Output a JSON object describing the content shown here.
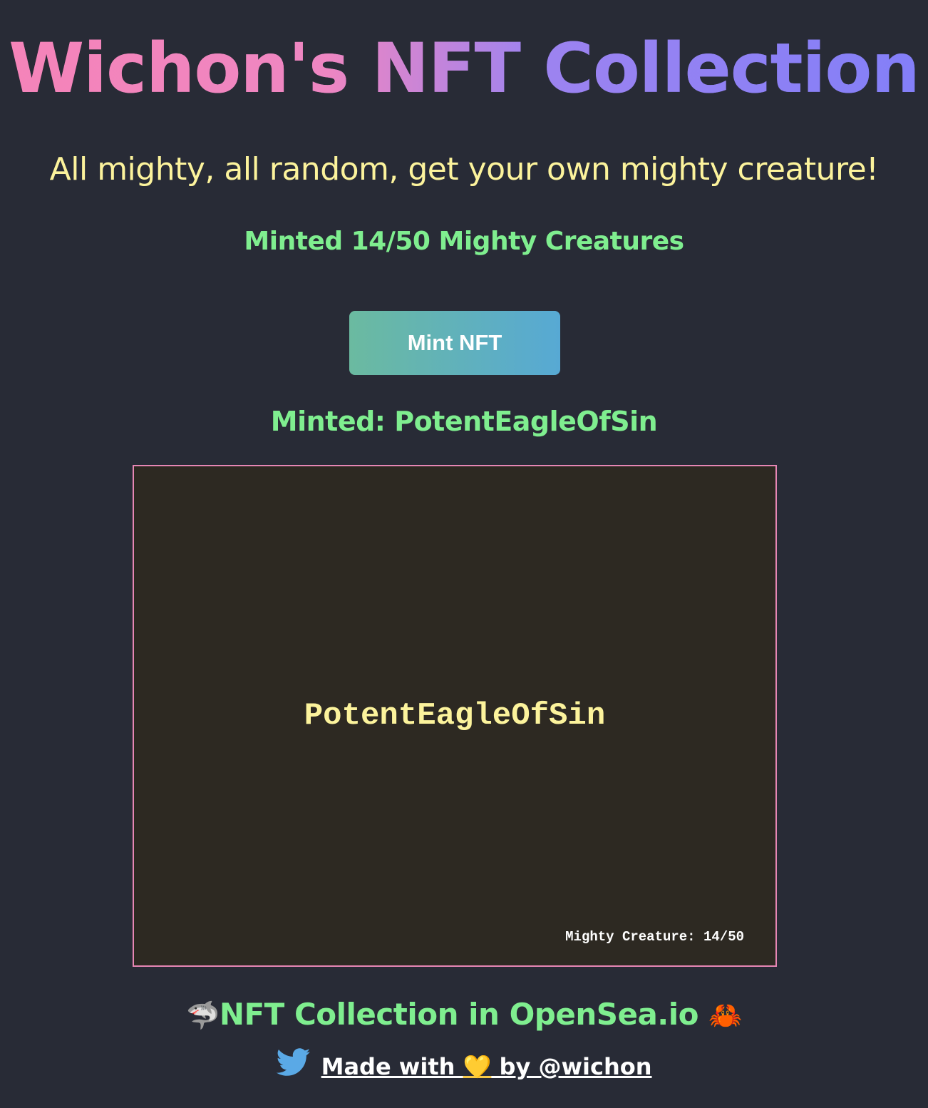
{
  "header": {
    "title": "Wichon's NFT Collection",
    "subtitle": "All mighty, all random, get your own mighty creature!",
    "counter": "Minted 14/50 Mighty Creatures"
  },
  "mint": {
    "button_label": "Mint NFT",
    "minted_message": "Minted: PotentEagleOfSin"
  },
  "nft": {
    "name": "PotentEagleOfSin",
    "footer": "Mighty Creature: 14/50"
  },
  "links": {
    "opensea_emoji_left": "🦈",
    "opensea_label": "NFT Collection in OpenSea.io",
    "opensea_emoji_right": "🦀",
    "made_with_prefix": "Made with ",
    "made_with_heart": "💛",
    "made_with_suffix": " by @wichon"
  },
  "colors": {
    "background": "#282b36",
    "title_gradient_start": "#f584b9",
    "title_gradient_end": "#837ff8",
    "subtitle": "#fcf39c",
    "accent_green": "#7fee8f",
    "button_gradient_start": "#6bbaa0",
    "button_gradient_end": "#57a9d4",
    "card_background": "#2d2922",
    "card_border": "#e686b4"
  },
  "icons": {
    "twitter": "twitter-bird-icon"
  }
}
